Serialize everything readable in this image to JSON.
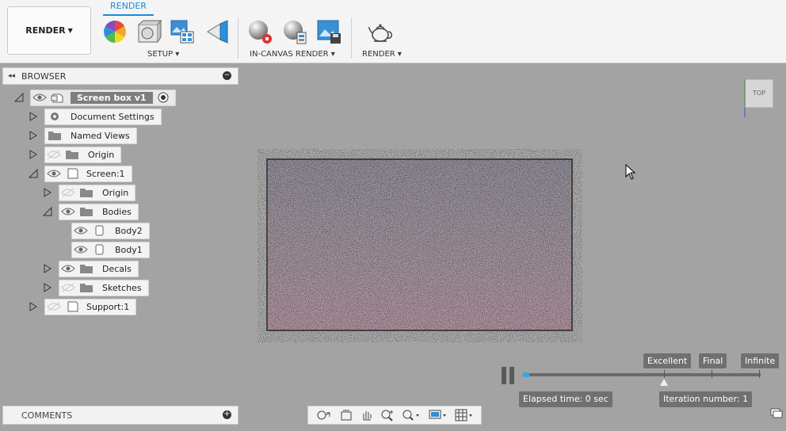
{
  "toolbar": {
    "workspace_label": "RENDER",
    "active_tab": "RENDER",
    "groups": [
      {
        "label": "SETUP ▾"
      },
      {
        "label": "IN-CANVAS RENDER ▾"
      },
      {
        "label": "RENDER ▾"
      }
    ]
  },
  "browser": {
    "title": "BROWSER",
    "items": [
      {
        "label": "Screen box v1"
      },
      {
        "label": "Document Settings"
      },
      {
        "label": "Named Views"
      },
      {
        "label": "Origin"
      },
      {
        "label": "Screen:1"
      },
      {
        "label": "Origin"
      },
      {
        "label": "Bodies"
      },
      {
        "label": "Body2"
      },
      {
        "label": "Body1"
      },
      {
        "label": "Decals"
      },
      {
        "label": "Sketches"
      },
      {
        "label": "Support:1"
      }
    ]
  },
  "comments": {
    "title": "COMMENTS"
  },
  "render_quality": {
    "levels": [
      "Excellent",
      "Final",
      "Infinite"
    ],
    "elapsed_label": "Elapsed time: 0 sec",
    "iteration_label": "Iteration number: 1",
    "progress_fraction": 0.02
  },
  "viewcube": {
    "face": "TOP"
  },
  "colors": {
    "accent": "#1a8ad6",
    "progress": "#35a7e8"
  }
}
